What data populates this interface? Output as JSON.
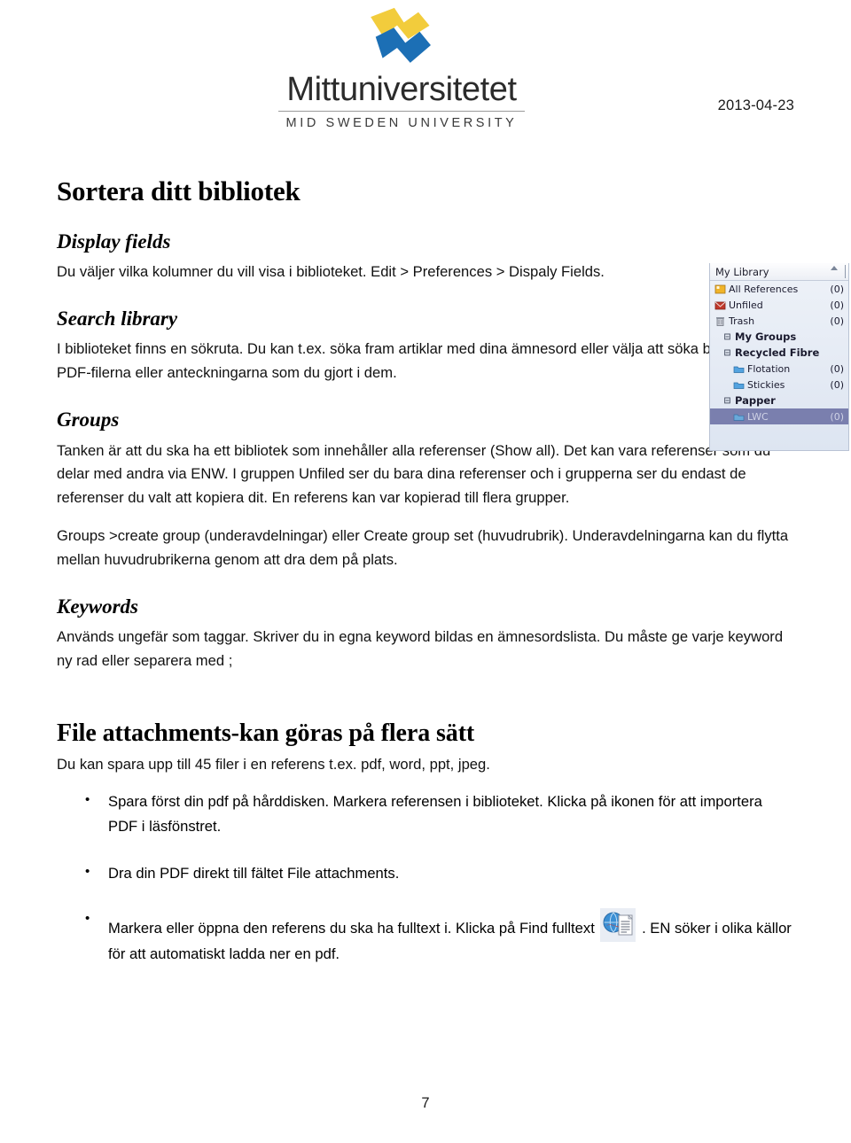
{
  "header": {
    "logo_word": "Mittuniversitetet",
    "logo_subtitle": "MID SWEDEN UNIVERSITY",
    "logo_colors": {
      "yellow": "#f2cc3c",
      "blue": "#1c6fb5"
    },
    "date": "2013-04-23"
  },
  "document": {
    "title": "Sortera ditt bibliotek",
    "sections": {
      "display_fields": {
        "heading": "Display fields",
        "paragraph": "Du väljer vilka kolumner du vill visa i biblioteket. Edit > Preferences > Dispaly Fields."
      },
      "search_library": {
        "heading": "Search library",
        "paragraph": "I biblioteket finns en sökruta. Du kan t.ex. söka fram artiklar med dina ämnesord eller välja att söka bland PDF-filerna eller anteckningarna som du gjort i dem."
      },
      "groups": {
        "heading": "Groups",
        "paragraph_1": "Tanken är att du ska ha ett bibliotek som innehåller alla referenser (Show all). Det kan vara referenser som du delar med andra via ENW. I gruppen Unfiled ser du bara dina referenser och i grupperna ser du endast de referenser du valt att kopiera dit. En referens kan var kopierad till flera grupper.",
        "paragraph_2": "Groups >create group (underavdelningar)  eller Create group set (huvudrubrik). Underavdelningarna kan du flytta mellan huvudrubrikerna genom att dra dem på plats."
      },
      "keywords": {
        "heading": "Keywords",
        "paragraph": "Används ungefär som taggar. Skriver du in egna keyword bildas en ämnesordslista. Du måste ge varje keyword ny rad eller separera med ;"
      },
      "file_attachments": {
        "heading": "File attachments-kan göras på flera sätt",
        "paragraph": "Du kan spara upp till 45 filer i en referens t.ex. pdf, word, ppt, jpeg.",
        "bullets": [
          {
            "text": "Spara först din pdf på hårddisken. Markera referensen i biblioteket. Klicka på ikonen för att importera PDF i läsfönstret."
          },
          {
            "text": "Dra din PDF direkt till fältet File attachments."
          },
          {
            "text_before": "Markera eller öppna den referens du ska ha fulltext i. Klicka på Find fulltext",
            "icon": "find-fulltext-icon",
            "text_after": ". EN söker i olika källor för att automatiskt ladda ner en pdf."
          }
        ]
      }
    }
  },
  "endnote_panel": {
    "title": "My Library",
    "selected_color": "#7a7fae",
    "rows": [
      {
        "label": "All References",
        "count": "(0)",
        "icon": "all-references-icon",
        "indent": 0,
        "type": "item"
      },
      {
        "label": "Unfiled",
        "count": "(0)",
        "icon": "unfiled-icon",
        "indent": 0,
        "type": "item"
      },
      {
        "label": "Trash",
        "count": "(0)",
        "icon": "trash-icon",
        "indent": 0,
        "type": "item"
      },
      {
        "label": "My Groups",
        "count": "",
        "icon": "expander-icon",
        "indent": 0,
        "type": "group-head"
      },
      {
        "label": "Recycled Fibre",
        "count": "",
        "icon": "expander-icon",
        "indent": 0,
        "type": "group-head"
      },
      {
        "label": "Flotation",
        "count": "(0)",
        "icon": "folder-icon",
        "indent": 2,
        "type": "item"
      },
      {
        "label": "Stickies",
        "count": "(0)",
        "icon": "folder-icon",
        "indent": 2,
        "type": "item"
      },
      {
        "label": "Papper",
        "count": "",
        "icon": "expander-icon",
        "indent": 0,
        "type": "group-head"
      },
      {
        "label": "LWC",
        "count": "(0)",
        "icon": "folder-icon",
        "indent": 2,
        "type": "item-selected"
      }
    ]
  },
  "footer": {
    "page_number": "7"
  }
}
